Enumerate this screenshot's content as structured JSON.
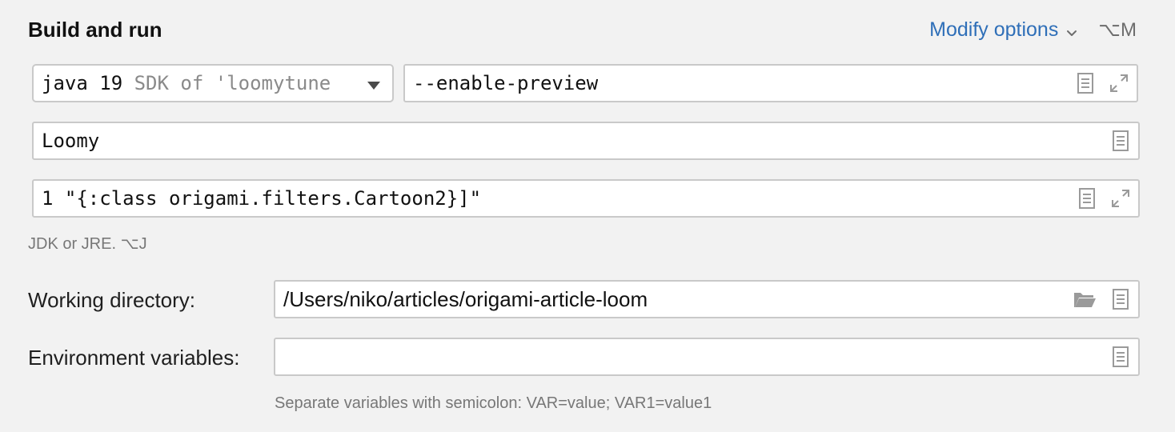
{
  "section": {
    "title": "Build and run"
  },
  "modify_options": {
    "label": "Modify options",
    "shortcut": "⌥M"
  },
  "jdk": {
    "value": "java 19",
    "detail": "SDK of 'loomytune"
  },
  "vm_options": {
    "value": "--enable-preview"
  },
  "main_class": {
    "value": "Loomy"
  },
  "program_args": {
    "value": "1 \"{:class origami.filters.Cartoon2}]\""
  },
  "jdk_hint": {
    "text": "JDK or JRE. ⌥J"
  },
  "working_directory": {
    "label": "Working directory:",
    "value": "/Users/niko/articles/origami-article-loom"
  },
  "environment_variables": {
    "label": "Environment variables:",
    "value": "",
    "hint": "Separate variables with semicolon: VAR=value; VAR1=value1"
  },
  "icons": {
    "dropdown": "triangle-down-icon",
    "document": "document-icon",
    "expand": "expand-icon",
    "folder": "folder-open-icon",
    "chevron": "chevron-down-icon"
  },
  "colors": {
    "link": "#2f6fb8",
    "background": "#f2f2f2",
    "field_border": "#c9c9c9",
    "muted_text": "#777777"
  }
}
